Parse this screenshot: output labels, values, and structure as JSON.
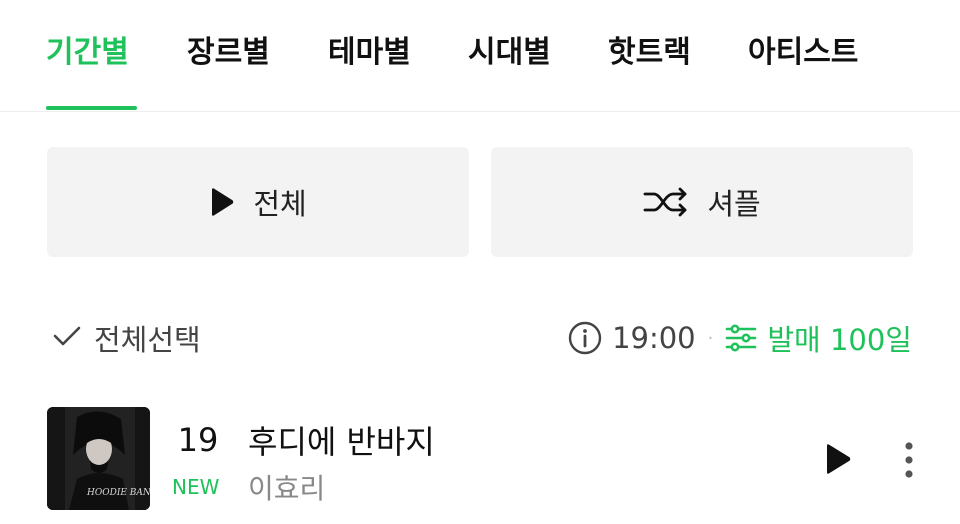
{
  "tabs": [
    {
      "label": "기간별",
      "active": true
    },
    {
      "label": "장르별",
      "active": false
    },
    {
      "label": "테마별",
      "active": false
    },
    {
      "label": "시대별",
      "active": false
    },
    {
      "label": "핫트랙",
      "active": false
    },
    {
      "label": "아티스트",
      "active": false
    }
  ],
  "actions": {
    "play_all_label": "전체",
    "play_all_icon": "play-icon",
    "shuffle_label": "셔플",
    "shuffle_icon": "shuffle-icon"
  },
  "toolbar": {
    "select_all_label": "전체선택",
    "select_all_icon": "check-icon",
    "info_icon": "info-icon",
    "time": "19:00",
    "separator": "·",
    "filter_icon": "sliders-icon",
    "filter_label": "발매 100일"
  },
  "track": {
    "rank": "19",
    "rank_change": "NEW",
    "title": "후디에 반바지",
    "artist": "이효리",
    "album_art_text": "HOODIE BANBAJI",
    "play_icon": "play-icon",
    "more_icon": "more-vertical-icon"
  },
  "colors": {
    "accent": "#1fc25a",
    "button_bg": "#f3f3f3",
    "text_primary": "#111111",
    "text_secondary": "#888888"
  }
}
